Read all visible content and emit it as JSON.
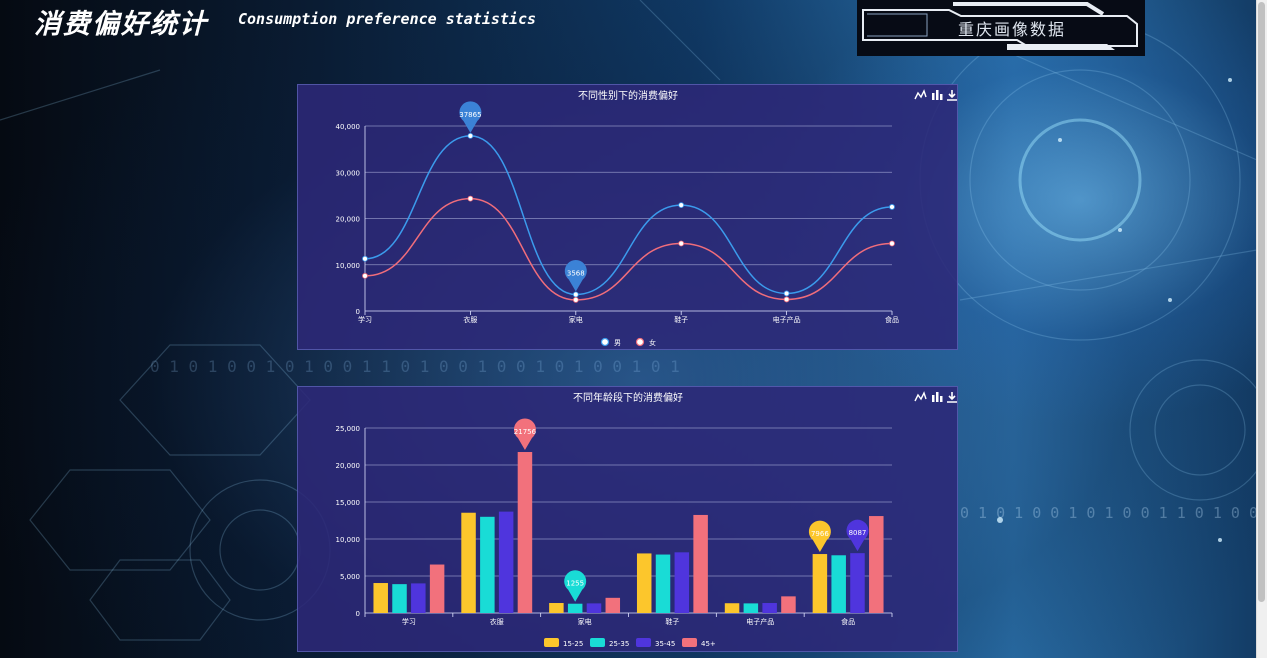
{
  "page": {
    "title": "消费偏好统计",
    "subtitle": "Consumption preference statistics",
    "brand": "重庆画像数据",
    "binary_text_1": "0 1 0 1 0 0 1 0 1 0 0 1 1 0 1 0 0 1 0 0 1 0 1 0 0 1 0 1",
    "binary_text_2": "0 1 0 1 0 0 1 0 1 0 0 1 1 0 1 0 0 1 0 1"
  },
  "icons": [
    "line-chart-icon",
    "bar-chart-icon",
    "download-icon"
  ],
  "chart_data": [
    {
      "type": "line",
      "smooth": true,
      "title": "不同性别下的消费偏好",
      "categories": [
        "学习",
        "衣服",
        "家电",
        "鞋子",
        "电子产品",
        "食品"
      ],
      "ylim": [
        0,
        40000
      ],
      "yticks": [
        "0",
        "10,000",
        "20,000",
        "30,000",
        "40,000"
      ],
      "yticks_values": [
        0,
        10000,
        20000,
        30000,
        40000
      ],
      "grid": true,
      "legend_position": "bottom-center",
      "series": [
        {
          "name": "男",
          "color": "#3b9bec",
          "values": [
            11300,
            37865,
            3568,
            22900,
            3800,
            22500
          ]
        },
        {
          "name": "女",
          "color": "#f06d7b",
          "values": [
            7600,
            24300,
            2400,
            14600,
            2500,
            14600
          ]
        }
      ],
      "markers": [
        {
          "series": 0,
          "index": 1,
          "label": "37865",
          "color": "#3b82d6"
        },
        {
          "series": 0,
          "index": 2,
          "label": "3568",
          "color": "#3b82d6"
        }
      ]
    },
    {
      "type": "bar",
      "title": "不同年龄段下的消费偏好",
      "categories": [
        "学习",
        "衣服",
        "家电",
        "鞋子",
        "电子产品",
        "食品"
      ],
      "ylim": [
        0,
        25000
      ],
      "yticks": [
        "0",
        "5,000",
        "10,000",
        "15,000",
        "20,000",
        "25,000"
      ],
      "yticks_values": [
        0,
        5000,
        10000,
        15000,
        20000,
        25000
      ],
      "grid": true,
      "legend_position": "bottom-center",
      "series": [
        {
          "name": "15-25",
          "color": "#fcc62c",
          "values": [
            4050,
            13550,
            1350,
            8050,
            1320,
            7966
          ]
        },
        {
          "name": "25-35",
          "color": "#19dcd6",
          "values": [
            3900,
            13000,
            1255,
            7900,
            1300,
            7800
          ]
        },
        {
          "name": "35-45",
          "color": "#4f35dd",
          "values": [
            4000,
            13700,
            1300,
            8200,
            1350,
            8087
          ]
        },
        {
          "name": "45+",
          "color": "#f2717c",
          "values": [
            6550,
            21756,
            2050,
            13250,
            2250,
            13100
          ]
        }
      ],
      "markers": [
        {
          "series": 3,
          "index": 1,
          "label": "21756",
          "color": "#f2717c"
        },
        {
          "series": 1,
          "index": 2,
          "label": "1255",
          "color": "#19dcd6"
        },
        {
          "series": 0,
          "index": 5,
          "label": "7966",
          "color": "#fcc62c"
        },
        {
          "series": 2,
          "index": 5,
          "label": "8087",
          "color": "#4f35dd"
        }
      ]
    }
  ]
}
